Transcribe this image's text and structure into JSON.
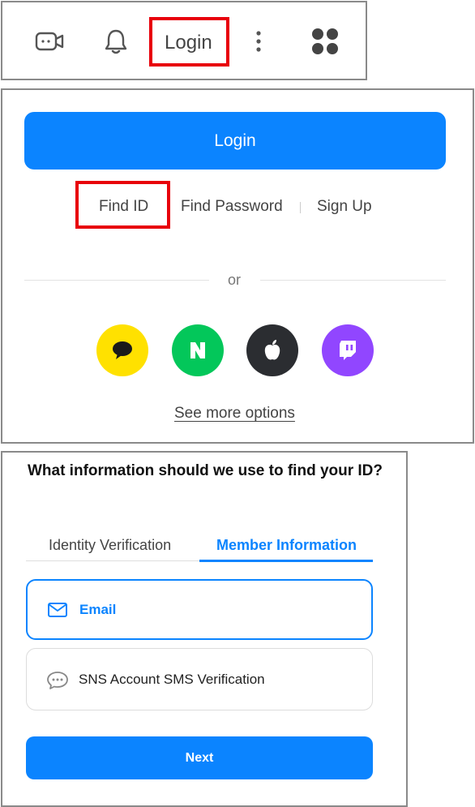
{
  "header": {
    "login_label": "Login"
  },
  "login_panel": {
    "login_button": "Login",
    "find_id": "Find ID",
    "find_password": "Find Password",
    "sign_up": "Sign Up",
    "or": "or",
    "sns": [
      {
        "name": "kakao",
        "icon": "speech-bubble-icon",
        "color": "#FFE100"
      },
      {
        "name": "naver",
        "icon": "naver-n-icon",
        "color": "#03C75A"
      },
      {
        "name": "apple",
        "icon": "apple-icon",
        "color": "#2B2D31"
      },
      {
        "name": "twitch",
        "icon": "twitch-icon",
        "color": "#9146FF"
      }
    ],
    "see_more": "See more options"
  },
  "find_id_panel": {
    "title": "What information should we use to find your ID?",
    "tabs": [
      {
        "label": "Identity Verification",
        "active": false
      },
      {
        "label": "Member Information",
        "active": true
      }
    ],
    "options": [
      {
        "label": "Email",
        "icon": "envelope-icon",
        "selected": true
      },
      {
        "label": "SNS Account SMS Verification",
        "icon": "chat-bubble-icon",
        "selected": false
      }
    ],
    "next_button": "Next"
  },
  "colors": {
    "primary": "#0B84FF",
    "highlight": "#E8000B"
  }
}
